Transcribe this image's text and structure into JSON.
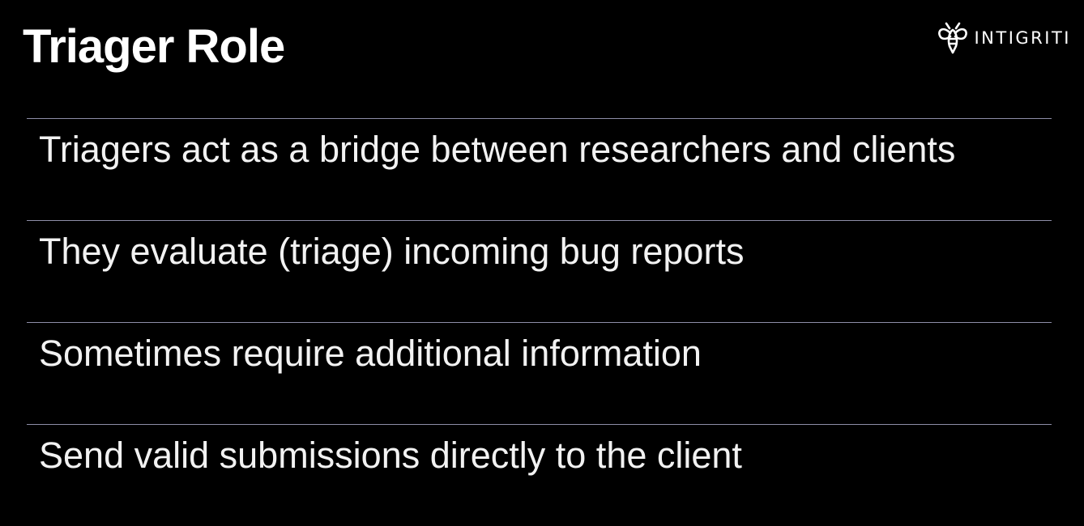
{
  "slide": {
    "title": "Triager Role"
  },
  "logo": {
    "icon": "bee-icon",
    "text": "INTIGRITI"
  },
  "bullets": [
    "Triagers act as a bridge between researchers and clients",
    "They evaluate (triage) incoming bug reports",
    "Sometimes require additional information",
    "Send valid submissions directly to the client"
  ],
  "colors": {
    "background": "#000000",
    "text": "#f2f2f2",
    "divider": "#8e8ea8"
  }
}
